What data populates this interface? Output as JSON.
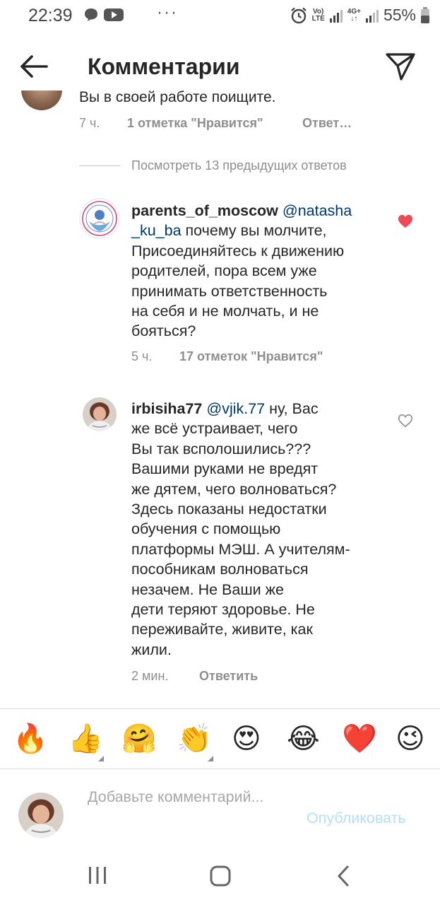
{
  "status_bar": {
    "time": "22:39",
    "dots": "···",
    "volte_top": "Vo)",
    "volte_bottom": "LTE",
    "net_top": "4G+",
    "net_bottom": "↓↑",
    "battery": "55%"
  },
  "header": {
    "title": "Комментарии"
  },
  "previous_comment": {
    "clipped_text": "Вы в своей работе поищите.",
    "time": "7 ч.",
    "likes": "1 отметка \"Нравится\"",
    "reply": "Ответ…"
  },
  "view_more": "Посмотреть 13 предыдущих ответов",
  "comments": [
    {
      "username": "parents_of_moscow",
      "mention": "@natasha _ku_ba",
      "text_lines": [
        "почему вы молчите,",
        "Присоединяйтесь к движению",
        "родителей, пора всем уже",
        "принимать ответственность",
        "на себя и не молчать, и не",
        "бояться?"
      ],
      "mention_line1": "@natasha",
      "mention_line2": "_ku_ba",
      "time": "5 ч.",
      "likes": "17 отметок \"Нравится\"",
      "liked": true
    },
    {
      "username": "irbisiha77",
      "mention": "@vjik.77",
      "first_line_rest": "ну, Вас",
      "text_lines": [
        "же всё устраивает, чего",
        "Вы так всполошились???",
        "Вашими руками не вредят",
        "же дятем, чего волноваться?",
        "Здесь показаны недостатки",
        "обучения с помощью",
        "платформы МЭШ. А  учителям-",
        "пособникам волноваться",
        "незачем. Не Ваши же",
        "дети теряют здоровье. Не",
        "переживайте, живите, как",
        "жили."
      ],
      "time": "2 мин.",
      "reply": "Ответить",
      "liked": false
    }
  ],
  "emoji_bar": [
    "🔥",
    "👍",
    "🤗",
    "👏",
    "😍",
    "😂",
    "❤️",
    "😉"
  ],
  "input": {
    "placeholder": "Добавьте комментарий...",
    "publish": "Опубликовать"
  },
  "colors": {
    "heart_liked": "#ed4956",
    "mention": "#00376b",
    "publish_disabled": "#b2dffc",
    "meta": "#8e8e8e"
  }
}
